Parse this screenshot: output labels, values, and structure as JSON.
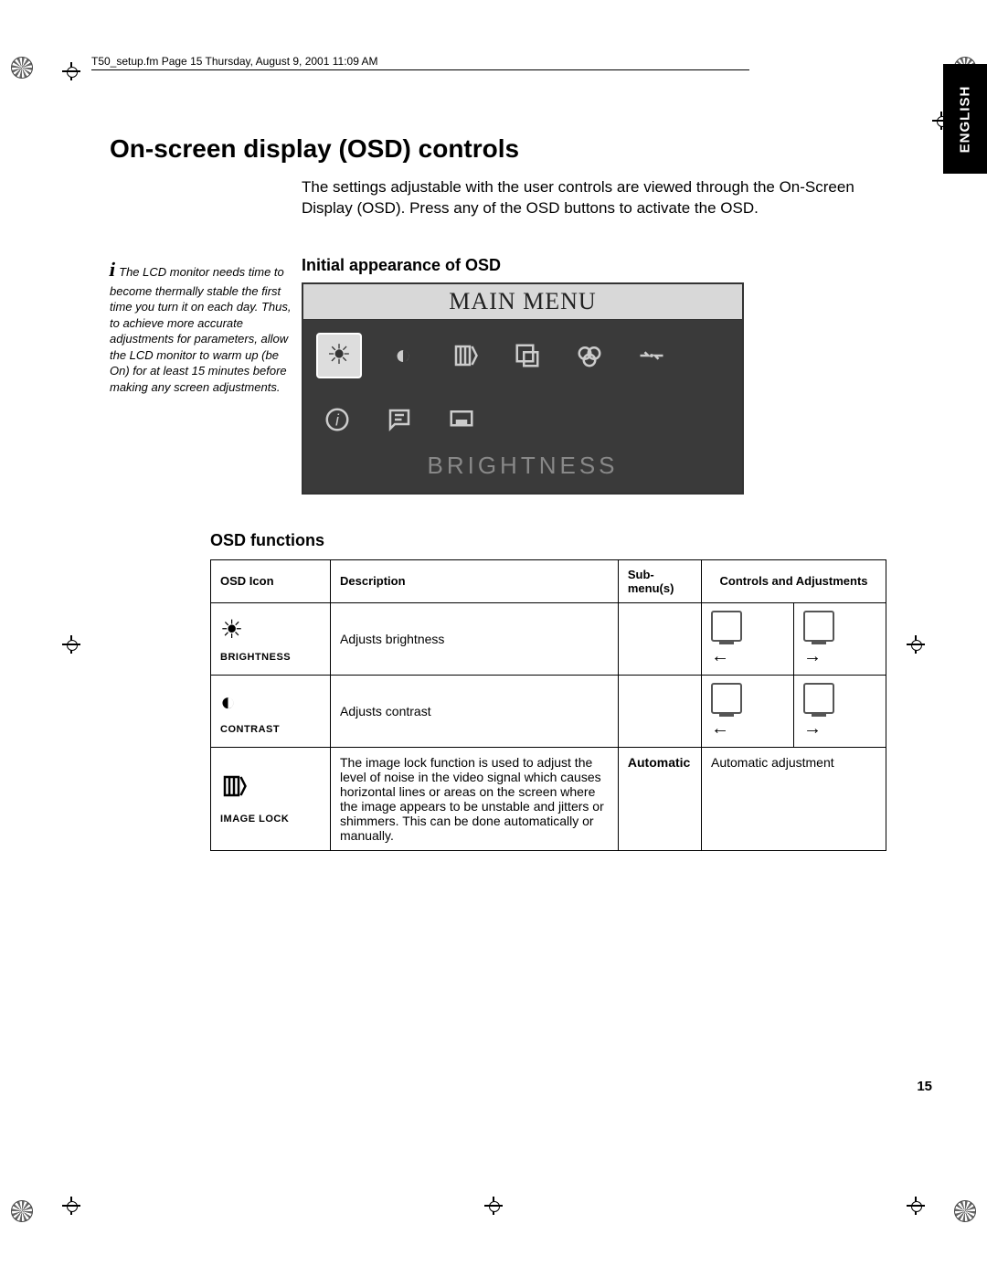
{
  "header": "T50_setup.fm  Page 15  Thursday, August 9, 2001  11:09 AM",
  "language_tab": "ENGLISH",
  "title": "On-screen display (OSD) controls",
  "intro": "The settings adjustable with the user controls are viewed through the On-Screen Display (OSD). Press any of the OSD buttons to activate the OSD.",
  "sidenote": "The LCD monitor needs time to become thermally stable the first time you turn it on each day. Thus, to achieve more accurate adjustments for parameters, allow the LCD monitor to warm up (be On) for at least 15 minutes before making any screen adjustments.",
  "section_initial": "Initial appearance of OSD",
  "osd": {
    "title": "MAIN MENU",
    "selected_label": "BRIGHTNESS",
    "icons": [
      "brightness",
      "contrast",
      "image-lock",
      "image-position",
      "color",
      "reset",
      "info",
      "language",
      "display-mode"
    ]
  },
  "section_functions": "OSD functions",
  "table": {
    "headers": [
      "OSD Icon",
      "Description",
      "Sub-menu(s)",
      "Controls and Adjustments"
    ],
    "rows": [
      {
        "icon": "brightness",
        "icon_label": "BRIGHTNESS",
        "desc": "Adjusts brightness",
        "submenu": "",
        "ctrl_left": "monitor-dim",
        "ctrl_right": "monitor-bright"
      },
      {
        "icon": "contrast",
        "icon_label": "CONTRAST",
        "desc": "Adjusts contrast",
        "submenu": "",
        "ctrl_left": "monitor-low-contrast",
        "ctrl_right": "monitor-high-contrast"
      },
      {
        "icon": "image-lock",
        "icon_label": "IMAGE LOCK",
        "desc": "The image lock function is used to adjust the level of noise in the video signal which causes horizontal lines or areas on the screen where the image appears to be unstable and jitters or shimmers. This can be done automatically or manually.",
        "submenu": "Automatic",
        "ctrl_text": "Automatic adjustment"
      }
    ]
  },
  "page_number": "15"
}
